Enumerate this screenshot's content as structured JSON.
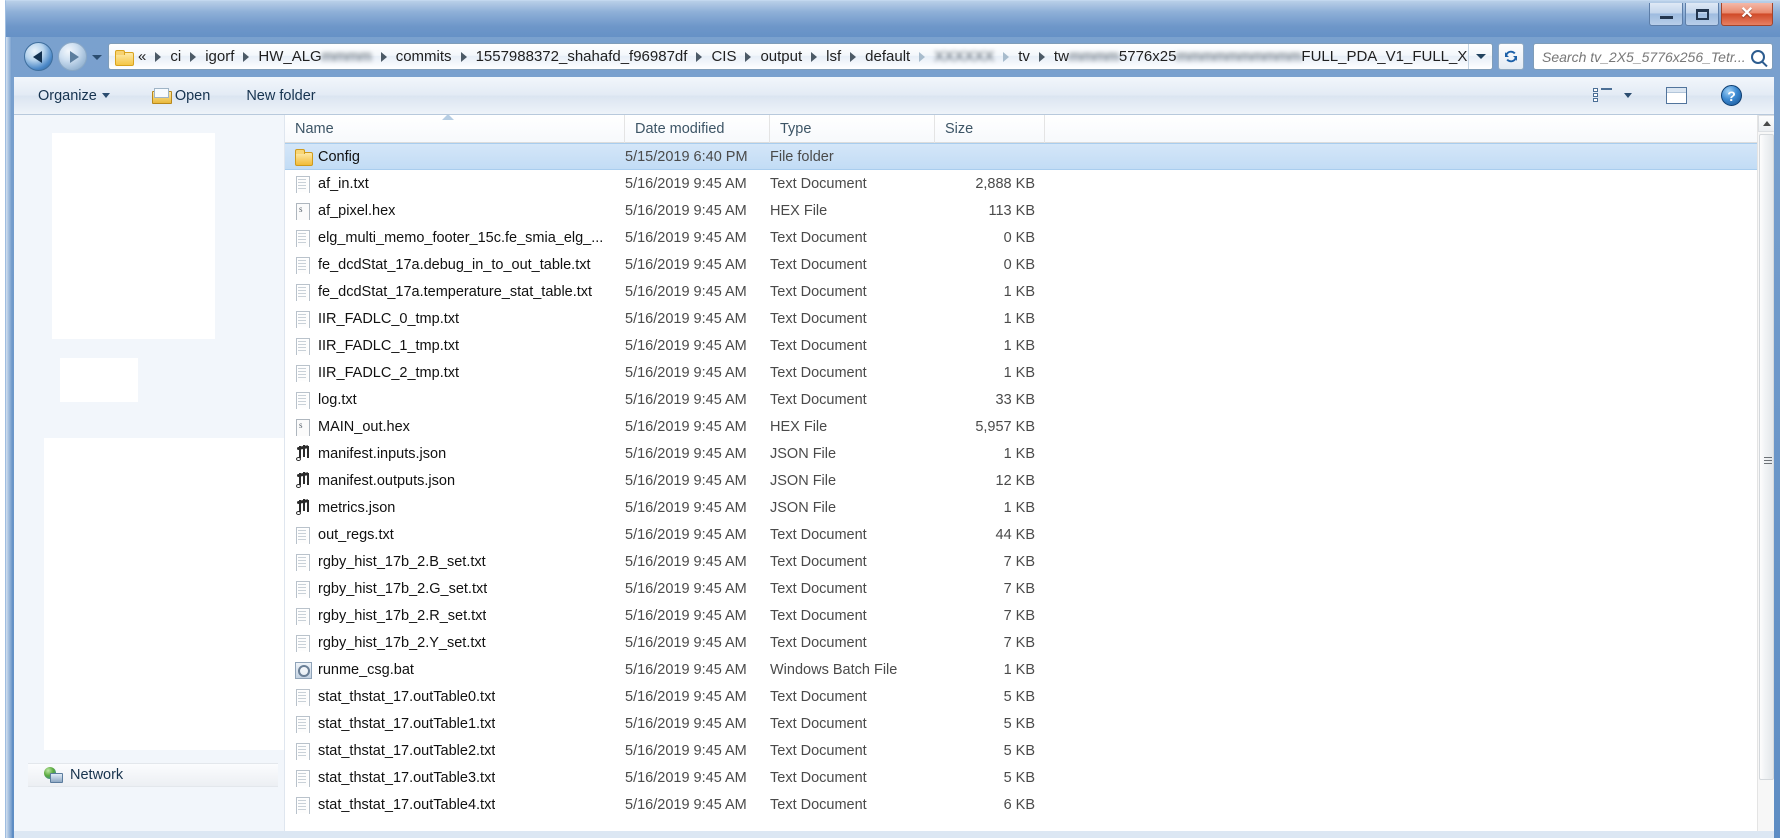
{
  "window": {
    "controls": {
      "minimize": "–",
      "maximize": "□",
      "close": "✕"
    }
  },
  "navbar": {
    "back_icon": "back-arrow-icon",
    "forward_icon": "forward-arrow-icon",
    "recent_icon": "chevron-down-icon",
    "breadcrumb": [
      {
        "label": "«",
        "blurred": false
      },
      {
        "label": "ci",
        "blurred": false
      },
      {
        "label": "igorf",
        "blurred": false
      },
      {
        "label": "HW_ALG",
        "blurred": false,
        "suffix_blurred": "mmmm"
      },
      {
        "label": "commits",
        "blurred": false
      },
      {
        "label": "1557988372_shahafd_f96987df",
        "blurred": false
      },
      {
        "label": "CIS",
        "blurred": false
      },
      {
        "label": "output",
        "blurred": false
      },
      {
        "label": "lsf",
        "blurred": false
      },
      {
        "label": "default",
        "blurred": false
      },
      {
        "label": "XXXXXX",
        "blurred": true
      },
      {
        "label": "tv",
        "blurred": false
      },
      {
        "label": "tw",
        "blurred": false,
        "suffix_blurred": "mmmm",
        "tail": "5776x25",
        "tail2_blurred": "mmmmmmmmmm",
        "tail3": "FULL_PDA_V1_FULL_X"
      }
    ],
    "address_dropdown_icon": "chevron-down-icon",
    "refresh_icon": "refresh-icon",
    "search": {
      "placeholder": "Search tv_2X5_5776x256_Tetr...",
      "value": "",
      "icon": "search-icon"
    }
  },
  "toolbar": {
    "organize_label": "Organize",
    "organize_caret": "chevron-down-icon",
    "open_label": "Open",
    "open_icon": "open-folder-icon",
    "new_folder_label": "New folder",
    "view_icon": "view-list-icon",
    "view_caret": "chevron-down-icon",
    "preview_pane_icon": "preview-pane-icon",
    "help_icon": "help-icon",
    "help_glyph": "?"
  },
  "navpane": {
    "network_label": "Network",
    "network_icon": "network-icon"
  },
  "filelist": {
    "columns": [
      {
        "key": "name",
        "label": "Name",
        "sorted": true,
        "sort_dir": "asc"
      },
      {
        "key": "date",
        "label": "Date modified"
      },
      {
        "key": "type",
        "label": "Type"
      },
      {
        "key": "size",
        "label": "Size"
      }
    ],
    "rows": [
      {
        "name": "Config",
        "date": "5/15/2019 6:40 PM",
        "type": "File folder",
        "size": "",
        "icon": "folder-icon",
        "selected": true
      },
      {
        "name": "af_in.txt",
        "date": "5/16/2019 9:45 AM",
        "type": "Text Document",
        "size": "2,888 KB",
        "icon": "text-file-icon",
        "selected": false
      },
      {
        "name": "af_pixel.hex",
        "date": "5/16/2019 9:45 AM",
        "type": "HEX File",
        "size": "113 KB",
        "icon": "hex-file-icon",
        "selected": false
      },
      {
        "name": "elg_multi_memo_footer_15c.fe_smia_elg_...",
        "date": "5/16/2019 9:45 AM",
        "type": "Text Document",
        "size": "0 KB",
        "icon": "text-file-icon",
        "selected": false
      },
      {
        "name": "fe_dcdStat_17a.debug_in_to_out_table.txt",
        "date": "5/16/2019 9:45 AM",
        "type": "Text Document",
        "size": "0 KB",
        "icon": "text-file-icon",
        "selected": false
      },
      {
        "name": "fe_dcdStat_17a.temperature_stat_table.txt",
        "date": "5/16/2019 9:45 AM",
        "type": "Text Document",
        "size": "1 KB",
        "icon": "text-file-icon",
        "selected": false
      },
      {
        "name": "IIR_FADLC_0_tmp.txt",
        "date": "5/16/2019 9:45 AM",
        "type": "Text Document",
        "size": "1 KB",
        "icon": "text-file-icon",
        "selected": false
      },
      {
        "name": "IIR_FADLC_1_tmp.txt",
        "date": "5/16/2019 9:45 AM",
        "type": "Text Document",
        "size": "1 KB",
        "icon": "text-file-icon",
        "selected": false
      },
      {
        "name": "IIR_FADLC_2_tmp.txt",
        "date": "5/16/2019 9:45 AM",
        "type": "Text Document",
        "size": "1 KB",
        "icon": "text-file-icon",
        "selected": false
      },
      {
        "name": "log.txt",
        "date": "5/16/2019 9:45 AM",
        "type": "Text Document",
        "size": "33 KB",
        "icon": "text-file-icon",
        "selected": false
      },
      {
        "name": "MAIN_out.hex",
        "date": "5/16/2019 9:45 AM",
        "type": "HEX File",
        "size": "5,957 KB",
        "icon": "hex-file-icon",
        "selected": false
      },
      {
        "name": "manifest.inputs.json",
        "date": "5/16/2019 9:45 AM",
        "type": "JSON File",
        "size": "1 KB",
        "icon": "json-file-icon",
        "selected": false
      },
      {
        "name": "manifest.outputs.json",
        "date": "5/16/2019 9:45 AM",
        "type": "JSON File",
        "size": "12 KB",
        "icon": "json-file-icon",
        "selected": false
      },
      {
        "name": "metrics.json",
        "date": "5/16/2019 9:45 AM",
        "type": "JSON File",
        "size": "1 KB",
        "icon": "json-file-icon",
        "selected": false
      },
      {
        "name": "out_regs.txt",
        "date": "5/16/2019 9:45 AM",
        "type": "Text Document",
        "size": "44 KB",
        "icon": "text-file-icon",
        "selected": false
      },
      {
        "name": "rgby_hist_17b_2.B_set.txt",
        "date": "5/16/2019 9:45 AM",
        "type": "Text Document",
        "size": "7 KB",
        "icon": "text-file-icon",
        "selected": false
      },
      {
        "name": "rgby_hist_17b_2.G_set.txt",
        "date": "5/16/2019 9:45 AM",
        "type": "Text Document",
        "size": "7 KB",
        "icon": "text-file-icon",
        "selected": false
      },
      {
        "name": "rgby_hist_17b_2.R_set.txt",
        "date": "5/16/2019 9:45 AM",
        "type": "Text Document",
        "size": "7 KB",
        "icon": "text-file-icon",
        "selected": false
      },
      {
        "name": "rgby_hist_17b_2.Y_set.txt",
        "date": "5/16/2019 9:45 AM",
        "type": "Text Document",
        "size": "7 KB",
        "icon": "text-file-icon",
        "selected": false
      },
      {
        "name": "runme_csg.bat",
        "date": "5/16/2019 9:45 AM",
        "type": "Windows Batch File",
        "size": "1 KB",
        "icon": "batch-file-icon",
        "selected": false
      },
      {
        "name": "stat_thstat_17.outTable0.txt",
        "date": "5/16/2019 9:45 AM",
        "type": "Text Document",
        "size": "5 KB",
        "icon": "text-file-icon",
        "selected": false
      },
      {
        "name": "stat_thstat_17.outTable1.txt",
        "date": "5/16/2019 9:45 AM",
        "type": "Text Document",
        "size": "5 KB",
        "icon": "text-file-icon",
        "selected": false
      },
      {
        "name": "stat_thstat_17.outTable2.txt",
        "date": "5/16/2019 9:45 AM",
        "type": "Text Document",
        "size": "5 KB",
        "icon": "text-file-icon",
        "selected": false
      },
      {
        "name": "stat_thstat_17.outTable3.txt",
        "date": "5/16/2019 9:45 AM",
        "type": "Text Document",
        "size": "5 KB",
        "icon": "text-file-icon",
        "selected": false
      },
      {
        "name": "stat_thstat_17.outTable4.txt",
        "date": "5/16/2019 9:45 AM",
        "type": "Text Document",
        "size": "6 KB",
        "icon": "text-file-icon",
        "selected": false
      }
    ]
  },
  "scrollbar": {
    "up_icon": "scroll-up-arrow-icon"
  },
  "colors": {
    "selection": "#c2dcf5",
    "frame": "#6f99ca",
    "accent": "#2c5c8f"
  }
}
